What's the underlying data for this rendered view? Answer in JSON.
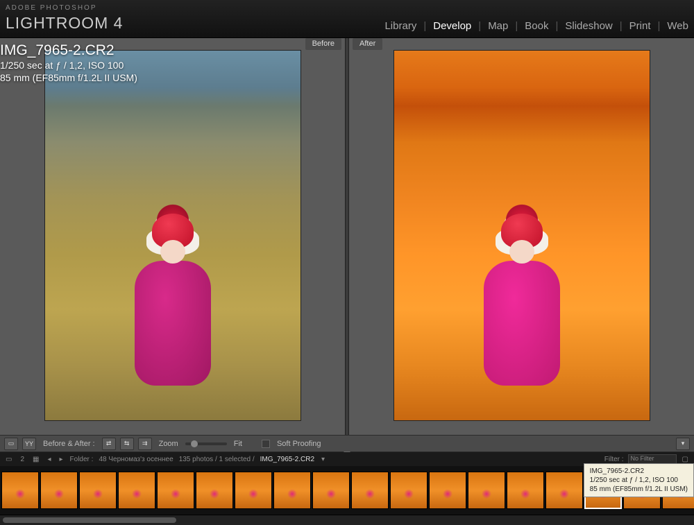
{
  "app": {
    "brand": "ADOBE PHOTOSHOP",
    "name": "LIGHTROOM 4"
  },
  "modules": {
    "items": [
      "Library",
      "Develop",
      "Map",
      "Book",
      "Slideshow",
      "Print",
      "Web"
    ],
    "active": "Develop"
  },
  "compare": {
    "before_label": "Before",
    "after_label": "After"
  },
  "file": {
    "name": "IMG_7965-2.CR2",
    "exposure": "1/250 sec at ƒ / 1,2, ISO 100",
    "lens": "85 mm (EF85mm f/1.2L II USM)"
  },
  "toolbar": {
    "before_after_label": "Before & After :",
    "zoom_label": "Zoom",
    "zoom_value": "Fit",
    "soft_proof_label": "Soft Proofing"
  },
  "breadcrumb": {
    "grid_badge": "2",
    "folder_prefix": "Folder :",
    "folder_name": "48 Черномаз'з осеннее",
    "count_text": "135 photos / 1 selected /",
    "current_file": "IMG_7965-2.CR2",
    "filter_label": "Filter :",
    "filter_value": "No Filter"
  },
  "tooltip": {
    "name": "IMG_7965-2.CR2",
    "line2": "1/250 sec at ƒ / 1,2, ISO 100",
    "line3": "85 mm (EF85mm f/1.2L II USM)"
  },
  "filmstrip": {
    "count": 18,
    "selected_index": 15
  }
}
